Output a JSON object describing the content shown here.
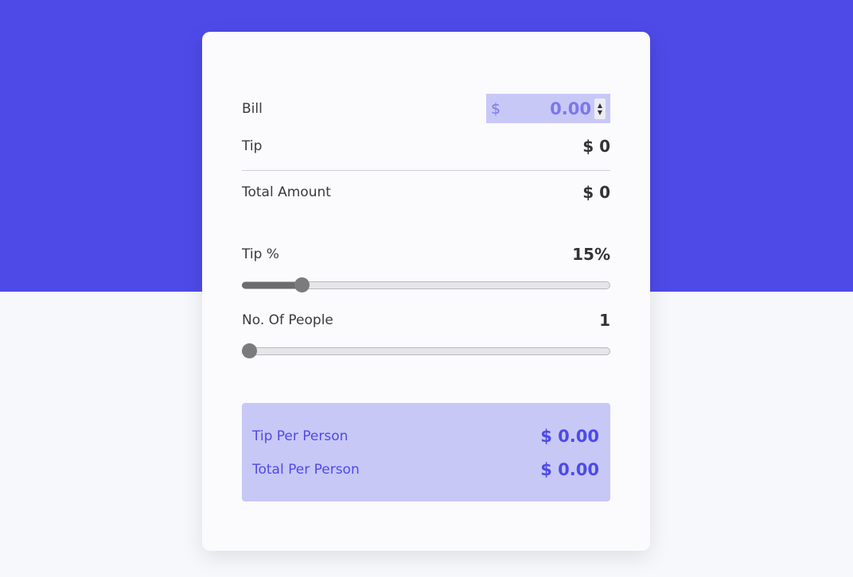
{
  "bill": {
    "label": "Bill",
    "currency": "$",
    "value": "0.00"
  },
  "tip": {
    "label": "Tip",
    "value": "$ 0"
  },
  "total_amount": {
    "label": "Total Amount",
    "value": "$ 0"
  },
  "tip_percent": {
    "label": "Tip %",
    "value": "15%",
    "slider_fraction": 0.15
  },
  "people": {
    "label": "No. Of People",
    "value": "1",
    "slider_fraction": 0
  },
  "summary": {
    "tip_per_person": {
      "label": "Tip Per Person",
      "value": "$ 0.00"
    },
    "total_per_person": {
      "label": "Total Per Person",
      "value": "$ 0.00"
    }
  },
  "colors": {
    "accent": "#4d4ae8",
    "accent_light": "#c8c8f7"
  },
  "icons": {
    "spinner": "number-spinner-icon"
  }
}
